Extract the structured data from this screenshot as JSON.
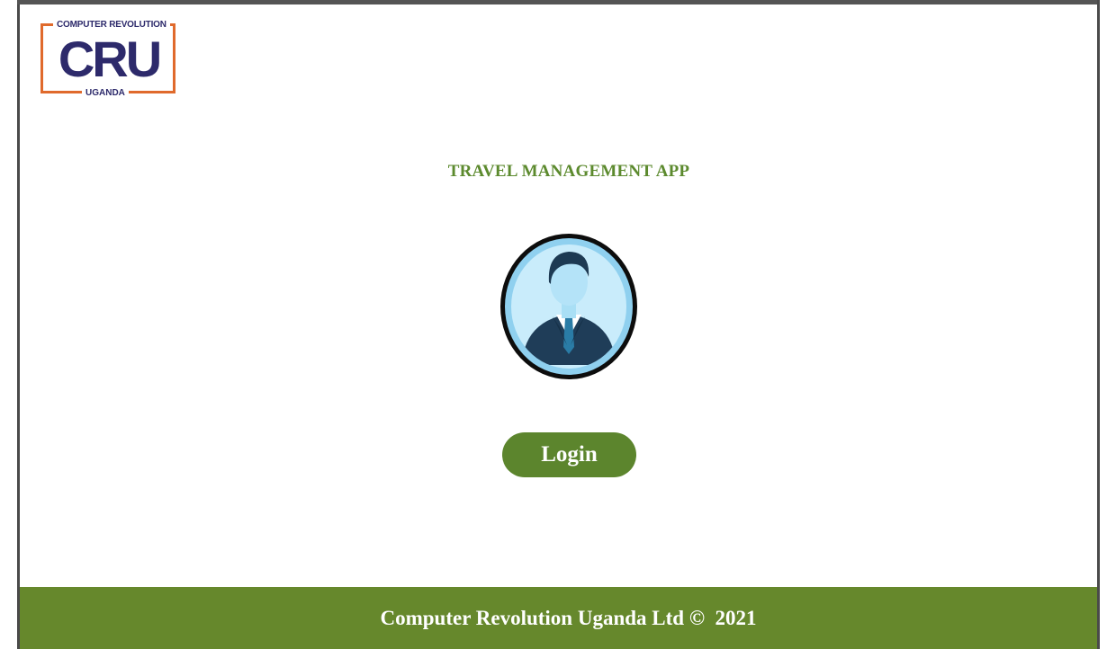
{
  "logo": {
    "top_text": "COMPUTER REVOLUTION",
    "main_text": "CRU",
    "bottom_text": "UGANDA"
  },
  "app": {
    "title": "TRAVEL MANAGEMENT APP"
  },
  "avatar": {
    "icon": "user-avatar-icon"
  },
  "login": {
    "label": "Login"
  },
  "footer": {
    "text": "Computer Revolution Uganda Ltd ©  2021"
  },
  "colors": {
    "accent_green": "#5c852d",
    "footer_green": "#66882c",
    "title_green": "#5c8a2e",
    "logo_orange": "#e06a2c",
    "logo_navy": "#2d2a6b"
  }
}
